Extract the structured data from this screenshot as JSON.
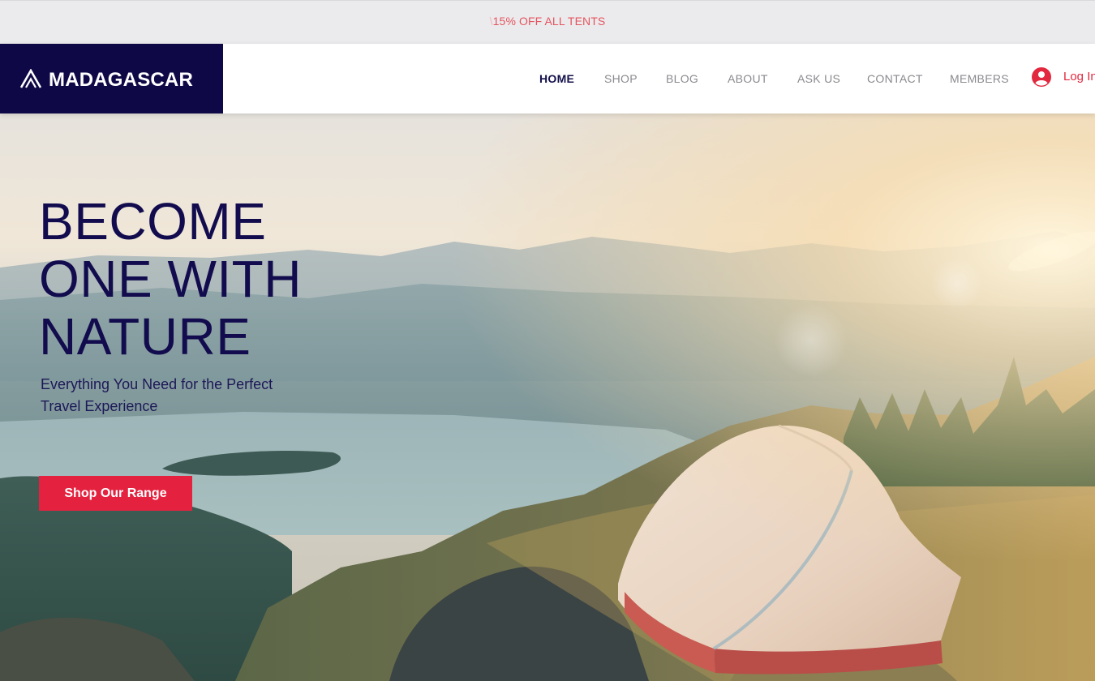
{
  "promo": {
    "fade_text": "\\",
    "text": "15% OFF ALL TENTS"
  },
  "brand": {
    "name": "MADAGASCAR",
    "logo_icon": "mountain-peak-icon",
    "color": "#0e0946"
  },
  "nav": {
    "items": [
      {
        "label": "HOME",
        "active": true
      },
      {
        "label": "SHOP",
        "active": false
      },
      {
        "label": "BLOG",
        "active": false
      },
      {
        "label": "ABOUT",
        "active": false
      },
      {
        "label": "ASK US",
        "active": false
      },
      {
        "label": "CONTACT",
        "active": false
      },
      {
        "label": "MEMBERS",
        "active": false
      }
    ],
    "login_icon": "user-avatar-icon",
    "login_label": "Log In"
  },
  "hero": {
    "headline": [
      "BECOME",
      "ONE WITH",
      "NATURE"
    ],
    "subheadline": "Everything You Need for the Perfect Travel Experience",
    "cta_label": "Shop Our Range",
    "cta_color": "#e4223f",
    "background_image": "tent-on-mountain-at-sunrise"
  }
}
